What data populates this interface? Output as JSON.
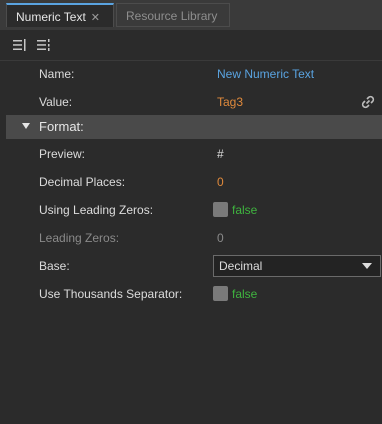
{
  "tabs": [
    {
      "label": "Numeric Text",
      "active": true
    },
    {
      "label": "Resource Library",
      "active": false
    }
  ],
  "toolbar": {
    "icons": [
      "align-left-icon",
      "align-right-icon"
    ]
  },
  "properties": {
    "name": {
      "label": "Name:",
      "value": "New Numeric Text"
    },
    "value": {
      "label": "Value:",
      "value": "Tag3",
      "icon": "link-icon"
    }
  },
  "format": {
    "section_label": "Format:",
    "preview": {
      "label": "Preview:",
      "value": "#"
    },
    "decimal_places": {
      "label": "Decimal Places:",
      "value": "0"
    },
    "using_leading_zeros": {
      "label": "Using Leading Zeros:",
      "value": "false"
    },
    "leading_zeros": {
      "label": "Leading Zeros:",
      "value": "0"
    },
    "base": {
      "label": "Base:",
      "value": "Decimal"
    },
    "use_thousands_separator": {
      "label": "Use Thousands Separator:",
      "value": "false"
    }
  },
  "colors": {
    "accent": "#5aa3e0",
    "tag": "#e08a3c",
    "false_text": "#3fb33f"
  }
}
